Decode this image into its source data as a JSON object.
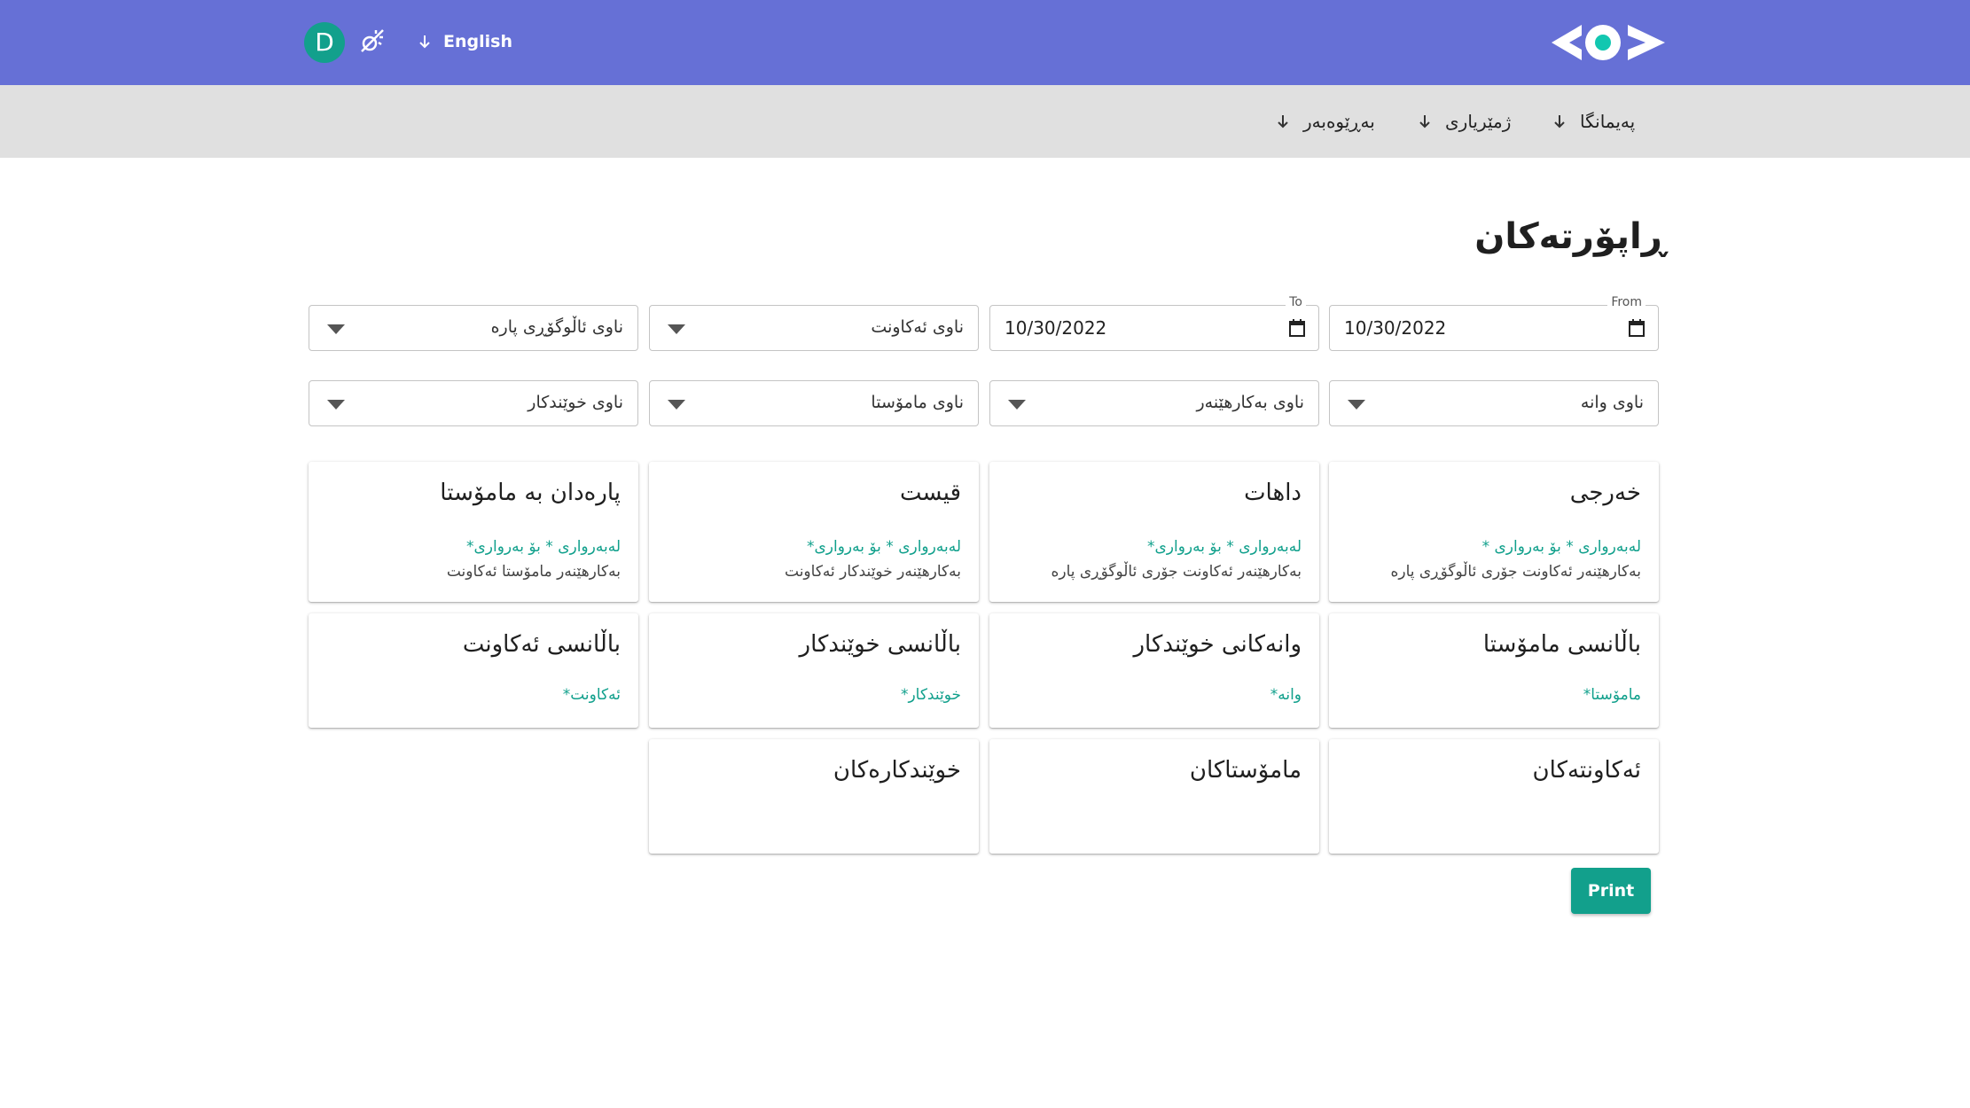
{
  "header": {
    "avatar_letter": "D",
    "language_label": "English",
    "colors": {
      "header_bg": "#6670d6",
      "accent": "#12a08c",
      "nav_bg": "#e0e0e0"
    }
  },
  "nav": {
    "items": [
      {
        "label": "پەیمانگا",
        "icon": "arrow-down-icon"
      },
      {
        "label": "ژمێریاری",
        "icon": "arrow-down-icon"
      },
      {
        "label": "بەڕێوەبەر",
        "icon": "arrow-down-icon"
      }
    ]
  },
  "page": {
    "title": "ڕاپۆرتەکان"
  },
  "filters": {
    "from": {
      "label": "From",
      "value": "10/30/2022"
    },
    "to": {
      "label": "To",
      "value": "10/30/2022"
    },
    "account": "ناوی ئەکاونت",
    "payment_type": "ناوی ئاڵوگۆڕی پارە",
    "lesson": "ناوی وانە",
    "user": "ناوی بەکارهێنەر",
    "teacher": "ناوی مامۆستا",
    "student": "ناوی خوێندکار"
  },
  "cards": {
    "expense": {
      "title": "خەرجی",
      "line1": "لەبەرواری * بۆ بەرواری *",
      "line2": "بەکارهێنەر ئەکاونت جۆری ئاڵوگۆڕی پارە"
    },
    "income": {
      "title": "داهات",
      "line1": "لەبەرواری * بۆ بەرواری*",
      "line2": "بەکارهێنەر ئەکاونت جۆری ئاڵوگۆڕی پارە"
    },
    "installment": {
      "title": "قیست",
      "line1": "لەبەرواری * بۆ بەرواری*",
      "line2": "بەکارهێنەر خوێندکار ئەکاونت"
    },
    "teacher_payment": {
      "title": "پارەدان بە مامۆستا",
      "line1": "لەبەرواری * بۆ بەرواری*",
      "line2": "بەکارهێنەر مامۆستا ئەکاونت"
    },
    "teacher_balance": {
      "title": "باڵانسی مامۆستا",
      "line1": "مامۆستا*"
    },
    "student_lessons": {
      "title": "وانەکانی خوێندکار",
      "line1": "وانە*"
    },
    "student_balance": {
      "title": "باڵانسی خوێندکار",
      "line1": "خوێندکار*"
    },
    "account_balance": {
      "title": "باڵانسی ئەکاونت",
      "line1": "ئەکاونت*"
    },
    "accounts": {
      "title": "ئەکاونتەکان"
    },
    "teachers": {
      "title": "مامۆستاکان"
    },
    "students": {
      "title": "خوێندکارەکان"
    }
  },
  "actions": {
    "print_label": "Print"
  }
}
